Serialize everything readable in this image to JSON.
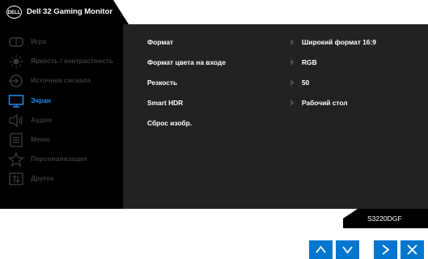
{
  "header": {
    "logo_text": "DELL",
    "title": "Dell 32 Gaming Monitor"
  },
  "sidebar": {
    "items": [
      {
        "label": "Игра",
        "icon": "game-icon"
      },
      {
        "label": "Яркость / контрастность",
        "icon": "brightness-icon"
      },
      {
        "label": "Источник сигнала",
        "icon": "input-source-icon"
      },
      {
        "label": "Экран",
        "icon": "display-icon",
        "active": true
      },
      {
        "label": "Аудио",
        "icon": "speaker-icon"
      },
      {
        "label": "Меню",
        "icon": "menu-icon"
      },
      {
        "label": "Персонализация",
        "icon": "star-icon"
      },
      {
        "label": "Другое",
        "icon": "other-icon"
      }
    ]
  },
  "settings": {
    "rows": [
      {
        "label": "Формат",
        "value": "Широкий формат 16:9"
      },
      {
        "label": "Формат цвета на входе",
        "value": "RGB"
      },
      {
        "label": "Резкость",
        "value": "50"
      },
      {
        "label": "Smart HDR",
        "value": "Рабочий стол"
      },
      {
        "label": "Сброс изобр.",
        "value": ""
      }
    ]
  },
  "footer": {
    "model": "S3220DGF"
  },
  "nav_buttons": [
    "up-arrow-icon",
    "down-arrow-icon",
    "right-arrow-icon",
    "close-icon"
  ],
  "colors": {
    "accent": "#0076ce",
    "active_text": "#1e8ae6",
    "inactive_text": "#3a3a3a",
    "osd_background": "#000000",
    "content_background": "#222222"
  }
}
